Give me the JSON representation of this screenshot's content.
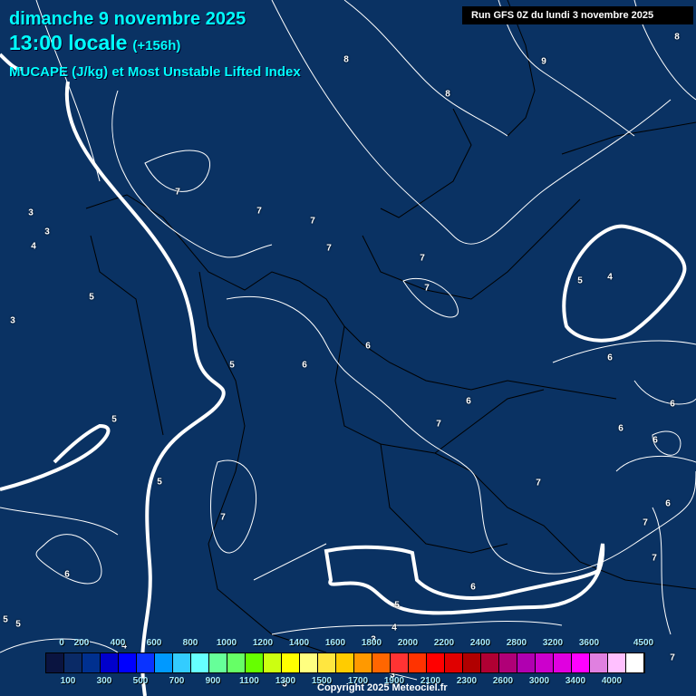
{
  "header": {
    "date": "dimanche 9 novembre 2025",
    "time": "13:00 locale",
    "lead": "(+156h)",
    "subtitle": "MUCAPE (J/kg) et Most Unstable Lifted Index",
    "run": "Run GFS 0Z du lundi 3 novembre 2025"
  },
  "contour_labels": [
    "8",
    "9",
    "8",
    "8",
    "7",
    "7",
    "7",
    "7",
    "7",
    "7",
    "5",
    "4",
    "3",
    "3",
    "4",
    "5",
    "3",
    "6",
    "6",
    "5",
    "6",
    "6",
    "6",
    "5",
    "7",
    "6",
    "6",
    "5",
    "7",
    "6",
    "7",
    "7",
    "6",
    "7",
    "6",
    "5",
    "5",
    "5",
    "4",
    "4",
    "3",
    "3",
    "3",
    "7"
  ],
  "legend": {
    "top_labels": [
      "0",
      "200",
      "400",
      "600",
      "800",
      "1000",
      "1200",
      "1400",
      "1600",
      "1800",
      "2000",
      "2200",
      "2400",
      "2800",
      "3200",
      "3600",
      "4500"
    ],
    "bottom_labels": [
      "100",
      "300",
      "500",
      "700",
      "900",
      "1100",
      "1300",
      "1500",
      "1700",
      "1900",
      "2100",
      "2300",
      "2600",
      "3000",
      "3400",
      "4000"
    ],
    "colors": [
      "#0a1440",
      "#0a2a66",
      "#00308f",
      "#0000cc",
      "#0000ff",
      "#0a33ff",
      "#0099ff",
      "#33ccff",
      "#66ffff",
      "#66ff99",
      "#66ff66",
      "#66ff00",
      "#ccff11",
      "#ffff00",
      "#ffff80",
      "#ffe640",
      "#ffcc00",
      "#ff9900",
      "#ff6600",
      "#ff3333",
      "#ff3300",
      "#ff0000",
      "#e00000",
      "#b00000",
      "#b00033",
      "#b00077",
      "#b000b0",
      "#cc00cc",
      "#e000e0",
      "#ff00ff",
      "#e080e0",
      "#ffc0ff",
      "#ffffff"
    ]
  },
  "copyright": "Copyright 2025 Meteociel.fr"
}
